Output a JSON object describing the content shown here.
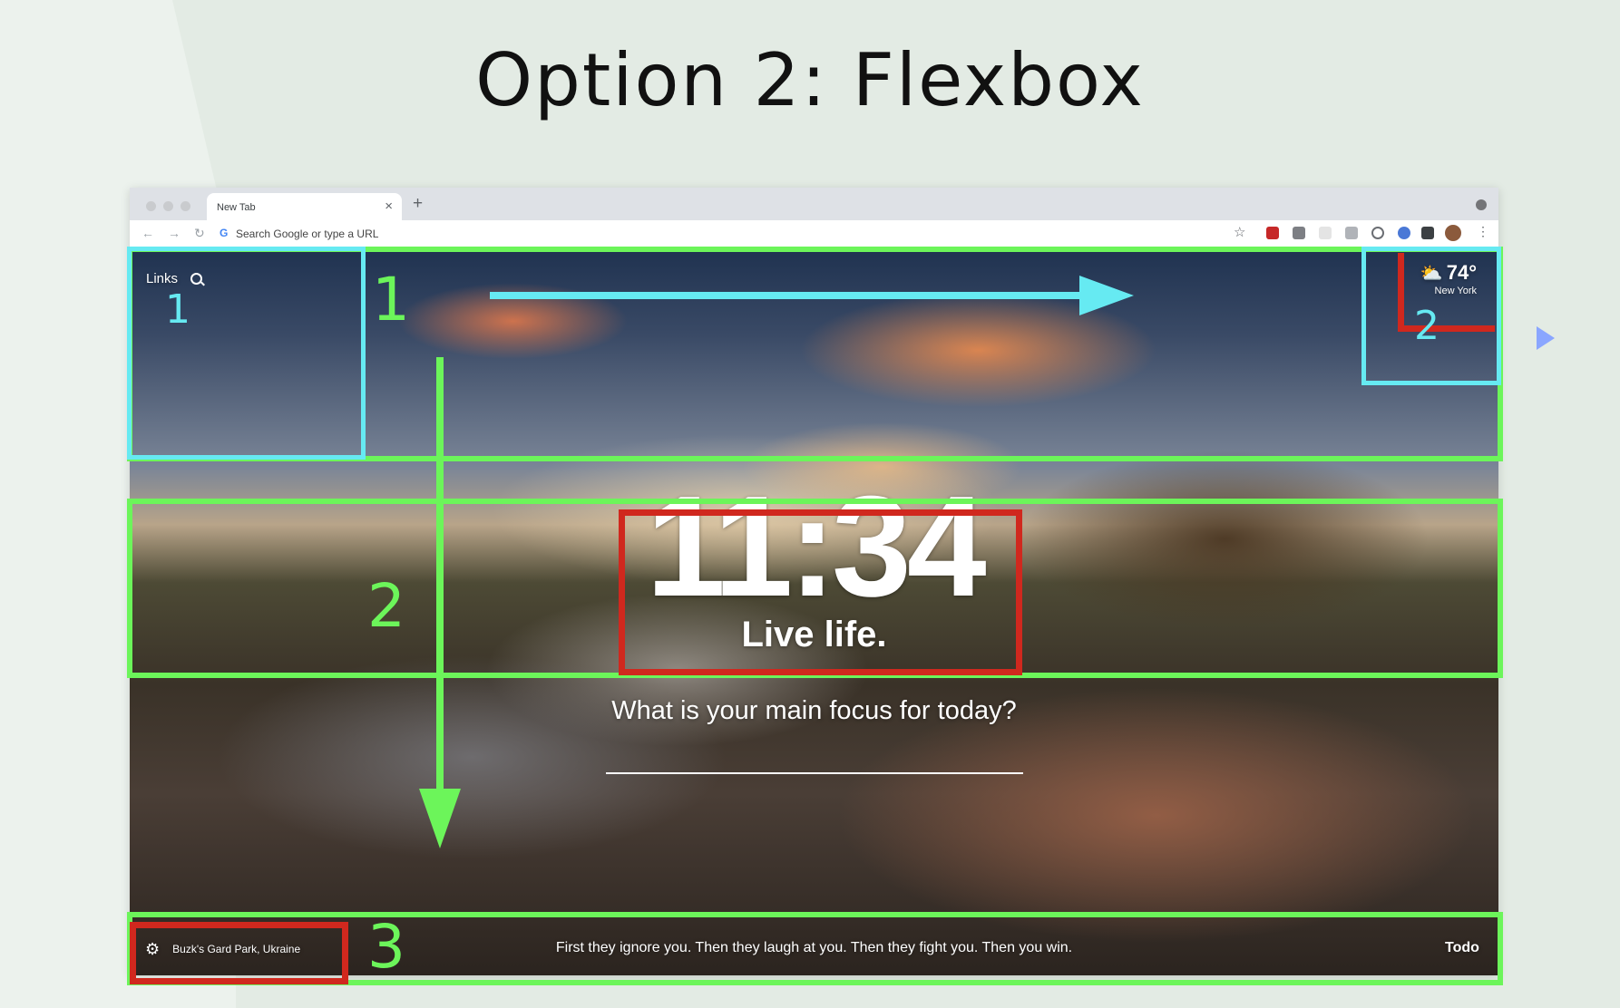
{
  "slide": {
    "title": "Option 2: Flexbox"
  },
  "browser": {
    "tab_title": "New Tab",
    "tab_close": "×",
    "new_tab": "+",
    "nav_back": "←",
    "nav_forward": "→",
    "nav_reload": "↻",
    "google_g": "G",
    "address_placeholder": "Search Google or type a URL",
    "bookmark": "☆",
    "menu": "⋮"
  },
  "app": {
    "links_label": "Links",
    "weather_icon": "⛅",
    "temperature": "74°",
    "city": "New York",
    "time": "11:34",
    "mantra": "Live life.",
    "focus_prompt": "What is your main focus for today?",
    "settings_icon": "⚙",
    "photo_location": "Buzk's Gard Park, Ukraine",
    "quote": "First they ignore you. Then they laugh at you. Then they fight you. Then you win.",
    "todo_label": "Todo"
  },
  "annotations": {
    "cyan_left_number": "1",
    "cyan_right_number": "2",
    "row1_number": "1",
    "row2_number": "2",
    "row3_number": "3",
    "colors": {
      "green": "#6cf55a",
      "cyan": "#66eaf2",
      "red": "#d0281e"
    }
  }
}
